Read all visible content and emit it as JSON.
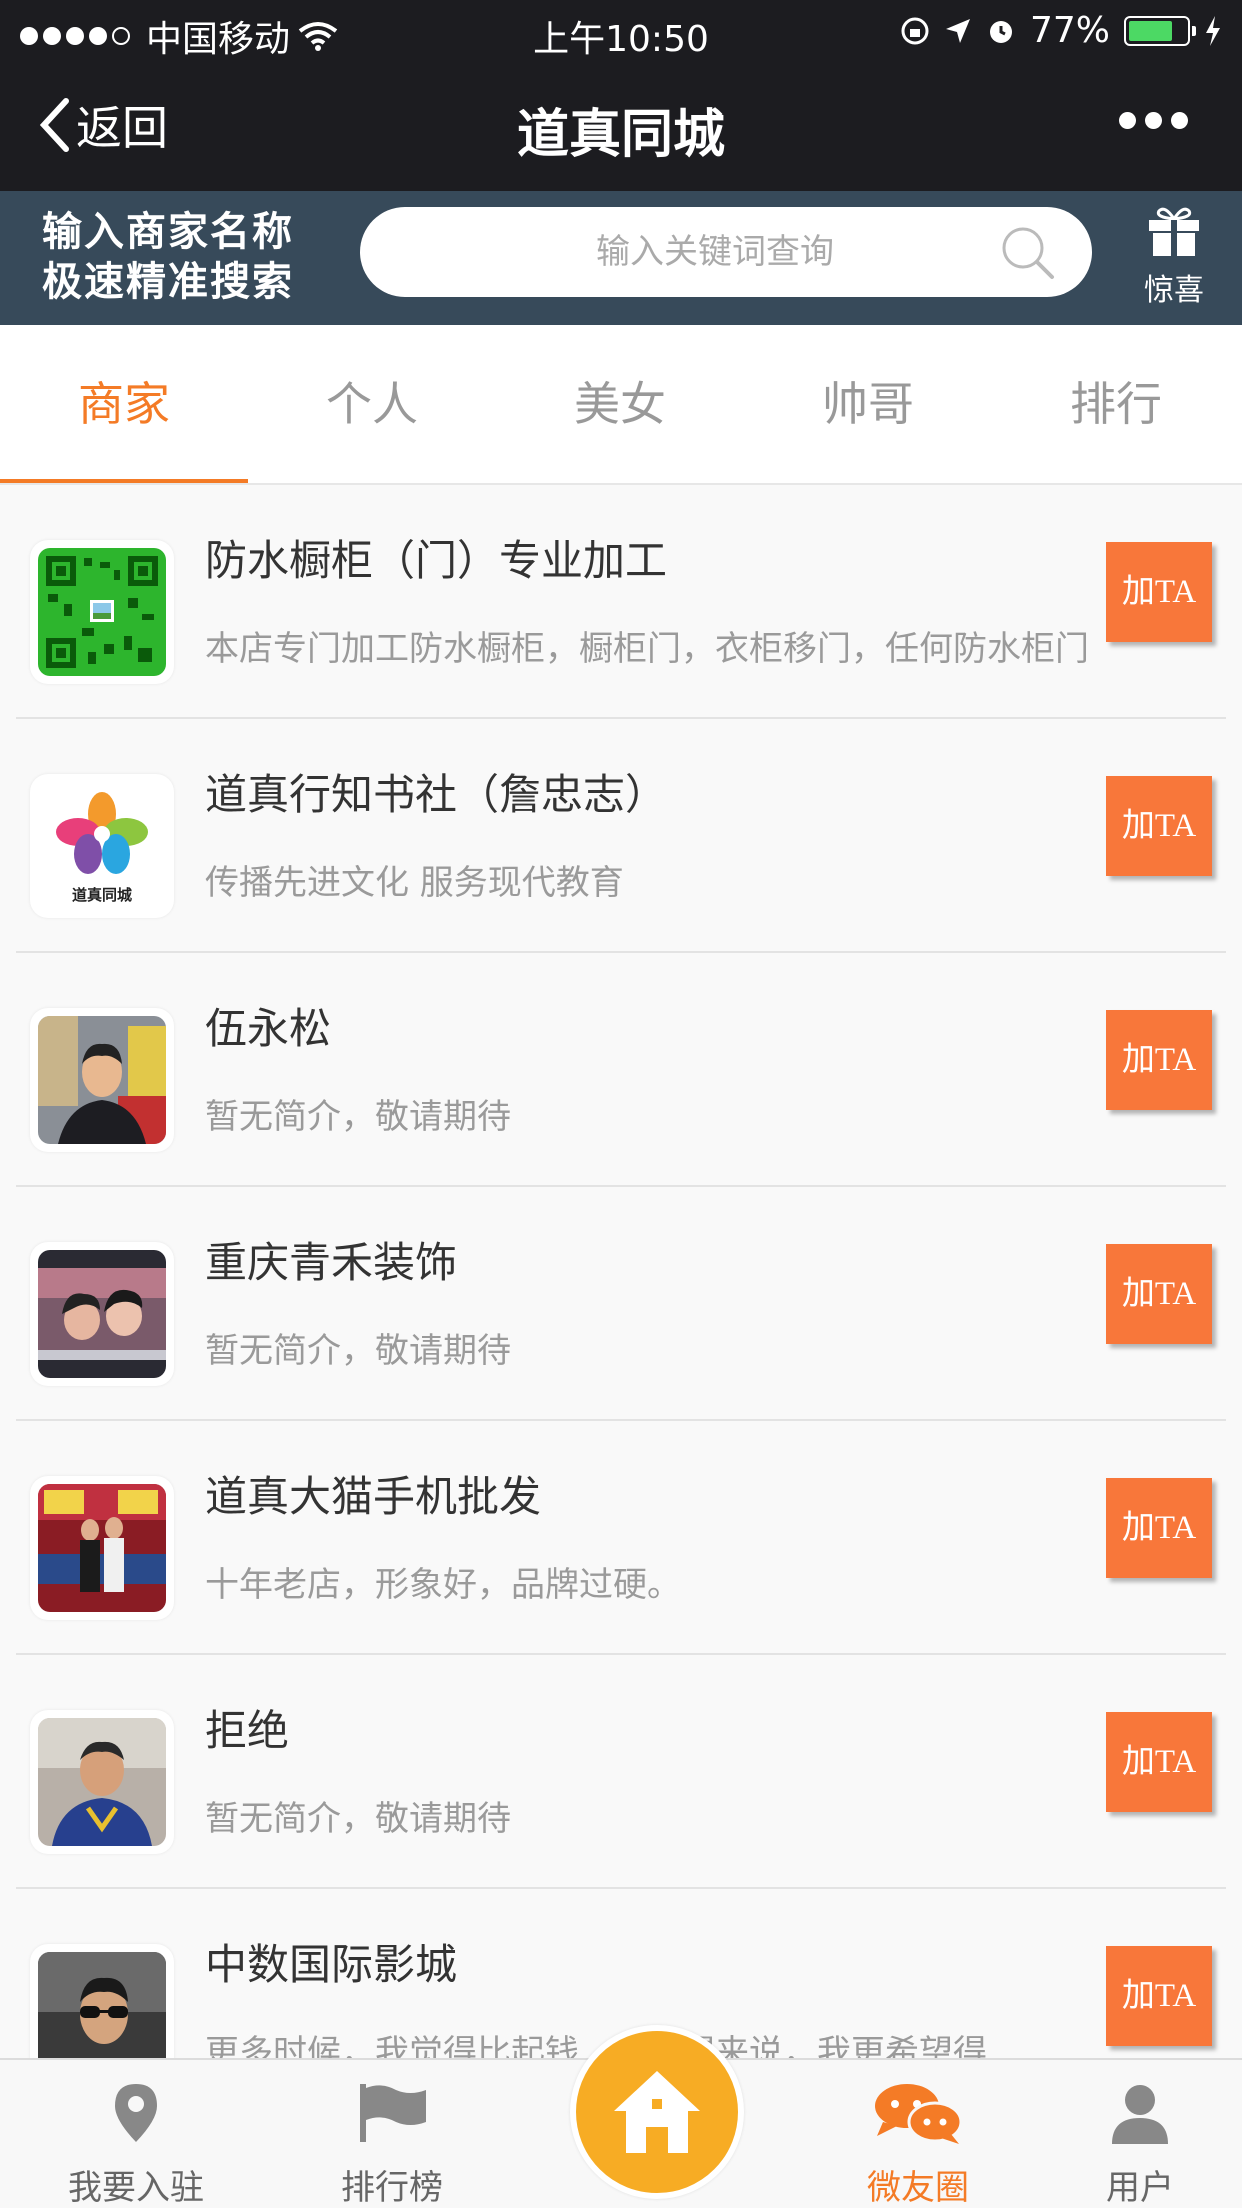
{
  "status_bar": {
    "carrier": "中国移动",
    "time": "上午10:50",
    "battery": "77%",
    "battery_level": 0.77
  },
  "nav": {
    "back_label": "返回",
    "title": "道真同城",
    "more_icon": "more-horizontal-icon"
  },
  "search": {
    "promo_line1": "输入商家名称",
    "promo_line2": "极速精准搜索",
    "placeholder": "输入关键词查询",
    "gift_label": "惊喜"
  },
  "tabs": [
    {
      "label": "商家",
      "active": true
    },
    {
      "label": "个人",
      "active": false
    },
    {
      "label": "美女",
      "active": false
    },
    {
      "label": "帅哥",
      "active": false
    },
    {
      "label": "排行",
      "active": false
    }
  ],
  "add_label": "加TA",
  "list": [
    {
      "name": "防水橱柜（门）专业加工",
      "desc": "本店专门加工防水橱柜，橱柜门，衣柜移门，任何防水柜门",
      "avatar": "qr-code"
    },
    {
      "name": "道真行知书社（詹忠志）",
      "desc": "传播先进文化 服务现代教育",
      "avatar": "logo",
      "logo_text": "道真同城"
    },
    {
      "name": "伍永松",
      "desc": "暂无简介，敬请期待",
      "avatar": "photo"
    },
    {
      "name": "重庆青禾装饰",
      "desc": "暂无简介，敬请期待",
      "avatar": "photo"
    },
    {
      "name": "道真大猫手机批发",
      "desc": "十年老店，形象好，品牌过硬。",
      "avatar": "photo"
    },
    {
      "name": "拒绝",
      "desc": "暂无简介，敬请期待",
      "avatar": "photo"
    },
    {
      "name": "中数国际影城",
      "desc": "更多时候，我觉得比起钱……名望来说，我更希望得……",
      "avatar": "photo"
    }
  ],
  "bottom_bar": [
    {
      "label": "我要入驻",
      "icon": "location-pin-icon"
    },
    {
      "label": "排行榜",
      "icon": "flag-icon"
    },
    {
      "label": "",
      "icon": "home-icon"
    },
    {
      "label": "微友圈",
      "icon": "chat-bubbles-icon",
      "active": true
    },
    {
      "label": "用户",
      "icon": "user-icon"
    }
  ],
  "colors": {
    "accent": "#f47b26",
    "header_bg": "#1c1c20",
    "search_band_bg": "#374a5a",
    "add_button": "#f8773a",
    "home_button": "#f7ac24"
  }
}
